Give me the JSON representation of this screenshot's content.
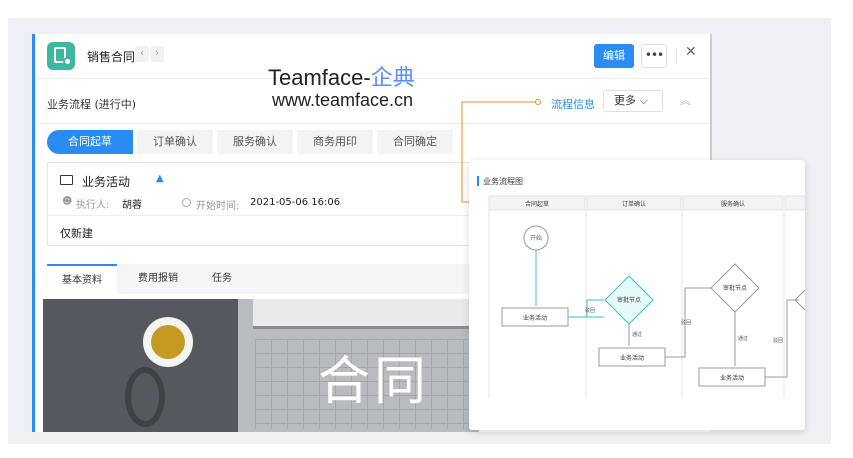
{
  "header": {
    "title": "销售合同",
    "prev_label": "‹",
    "next_label": "›",
    "edit_label": "编辑",
    "more_label": "•••",
    "close_label": "✕"
  },
  "watermark": {
    "line1_en": "Teamface-",
    "line1_cn": "企典",
    "line2": "www.teamface.cn"
  },
  "flow": {
    "title": "业务流程 (进行中)",
    "info_link": "流程信息",
    "more_select": "更多 ⌵",
    "collapse": "︽",
    "steps": [
      {
        "label": "合同起草",
        "active": true
      },
      {
        "label": "订单确认",
        "active": false
      },
      {
        "label": "服务确认",
        "active": false
      },
      {
        "label": "商务用印",
        "active": false
      },
      {
        "label": "合同确定",
        "active": false
      }
    ]
  },
  "activity": {
    "title": "业务活动",
    "executor_label": "执行人:",
    "executor_name": "胡蓉",
    "start_label": "开始时间:",
    "start_value": "2021-05-06 16:06",
    "note": "仅新建"
  },
  "tabs": [
    {
      "label": "基本资料",
      "active": true
    },
    {
      "label": "费用报销",
      "active": false
    },
    {
      "label": "任务",
      "active": false
    }
  ],
  "photo": {
    "overlay_text": "合同"
  },
  "diagram": {
    "title": "业务流程图",
    "lanes": [
      "合同起草",
      "订单确认",
      "服务确认"
    ],
    "start_node": "开始",
    "nodes": {
      "activity_1": "业务活动",
      "approve_1": "审批节点",
      "activity_2": "业务活动",
      "approve_2": "审批节点",
      "activity_3": "业务活动"
    },
    "edge_labels": {
      "reject_1": "驳回",
      "pass_1": "通过",
      "reject_2": "驳回",
      "pass_2": "通过",
      "reject_3": "驳回"
    }
  },
  "colors": {
    "accent": "#2a8cf0",
    "app_icon": "#3fb6a0",
    "connector": "#f08c2a",
    "highlight_node": "#35c9c1"
  }
}
